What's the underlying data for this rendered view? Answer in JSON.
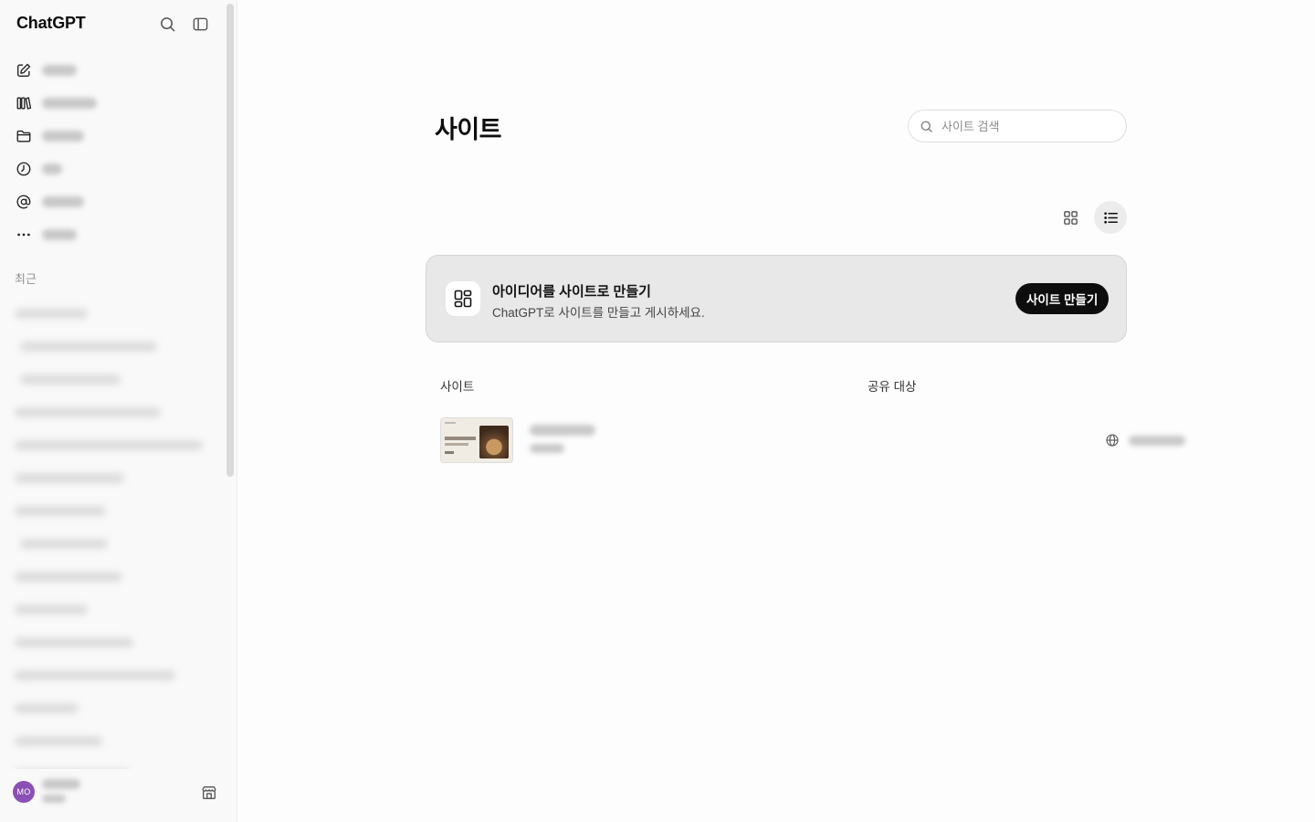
{
  "sidebar": {
    "brand": "ChatGPT",
    "recent_label": "최근",
    "nav_icons": [
      "edit-icon",
      "library-icon",
      "folder-icon",
      "clock-icon",
      "at-sign-icon",
      "more-icon"
    ],
    "footer": {
      "avatar_initials": "MO"
    }
  },
  "main": {
    "title": "사이트",
    "search": {
      "placeholder": "사이트 검색",
      "value": ""
    },
    "banner": {
      "title": "아이디어를 사이트로 만들기",
      "description": "ChatGPT로 사이트를 만들고 게시하세요.",
      "button_label": "사이트 만들기"
    },
    "table": {
      "columns": [
        "사이트",
        "공유 대상"
      ]
    }
  }
}
